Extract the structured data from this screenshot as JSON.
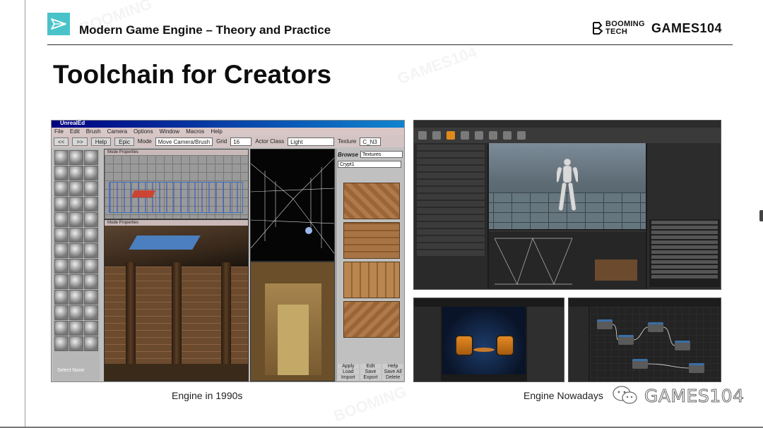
{
  "header": {
    "course_title": "Modern Game Engine – Theory and Practice",
    "brand_booming_line1": "BOOMING",
    "brand_booming_line2": "TECH",
    "brand_games": "GAMES104"
  },
  "slide": {
    "title": "Toolchain for Creators"
  },
  "captions": {
    "left": "Engine in 1990s",
    "right": "Engine Nowadays"
  },
  "watermark": {
    "text": "GAMES104",
    "background_words": [
      "BOOMING",
      "GAMES104"
    ]
  },
  "old_editor": {
    "window_title": "UnrealEd",
    "menu": [
      "File",
      "Edit",
      "Brush",
      "Camera",
      "Options",
      "Window",
      "Macros",
      "Help"
    ],
    "toolbar": {
      "help_label": "Help",
      "epic_label": "Epic",
      "mode_label": "Mode",
      "mode_value": "Move Camera/Brush",
      "grid_label": "Grid",
      "grid_value": "16",
      "actor_class_label": "Actor Class",
      "actor_class_value": "Light",
      "texture_label": "Texture",
      "texture_value": "C_N3"
    },
    "viewport_header": "Mode   Properties",
    "browser": {
      "label": "Browse",
      "type_value": "Textures",
      "package_value": "Crypt1",
      "buttons": [
        "Apply",
        "Edit",
        "Help",
        "Load",
        "Save",
        "Save All",
        "Import",
        "Export",
        "Delete"
      ]
    },
    "select_none": "Select None"
  },
  "colors": {
    "accent_logo": "#49c3c9",
    "title_text": "#0d0d0d",
    "ue_highlight": "#e08a1c"
  }
}
